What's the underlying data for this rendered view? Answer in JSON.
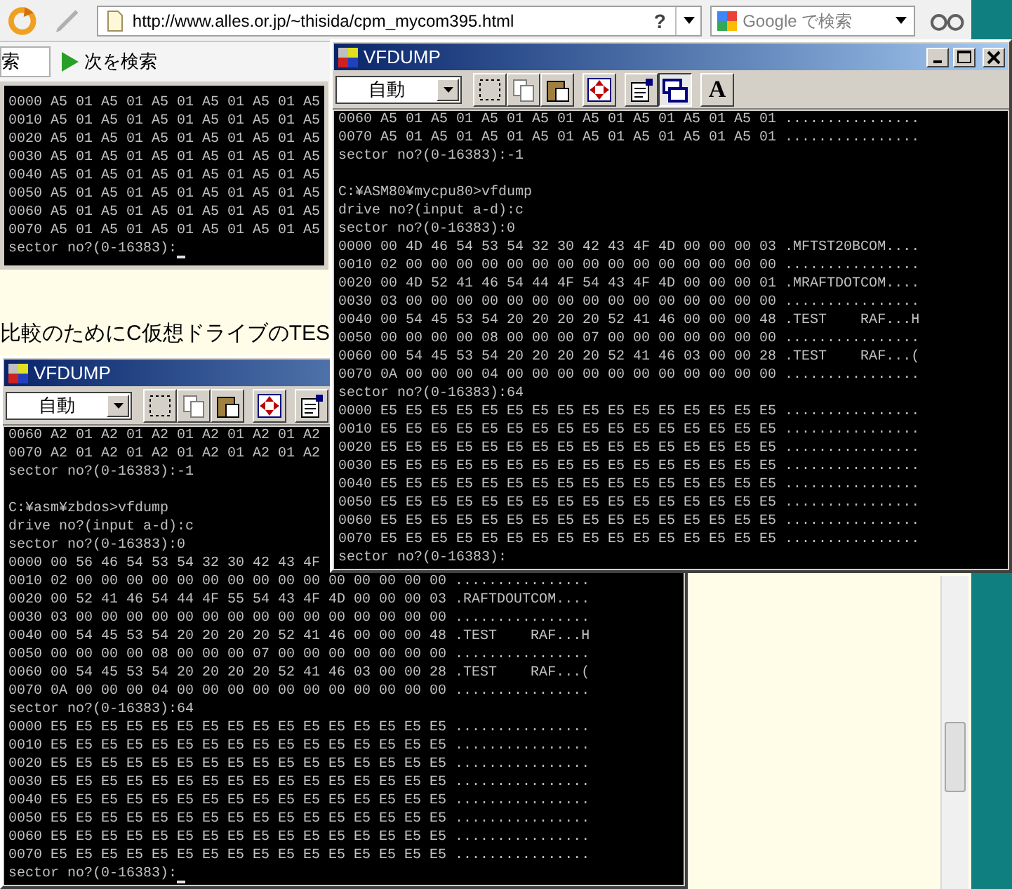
{
  "browser": {
    "url": "http://www.alles.or.jp/~thisida/cpm_mycom395.html",
    "help_button": "?",
    "search_placeholder": "Google で検索",
    "find_field_text": "索",
    "find_next": "次を検索"
  },
  "page": {
    "text": "比較のためにC仮想ドライブのTES"
  },
  "console_fragment": {
    "cursor": true,
    "lines": [
      "0000 A5 01 A5 01 A5 01 A5 01 A5 01 A5",
      "0010 A5 01 A5 01 A5 01 A5 01 A5 01 A5",
      "0020 A5 01 A5 01 A5 01 A5 01 A5 01 A5",
      "0030 A5 01 A5 01 A5 01 A5 01 A5 01 A5",
      "0040 A5 01 A5 01 A5 01 A5 01 A5 01 A5",
      "0050 A5 01 A5 01 A5 01 A5 01 A5 01 A5",
      "0060 A5 01 A5 01 A5 01 A5 01 A5 01 A5",
      "0070 A5 01 A5 01 A5 01 A5 01 A5 01 A5",
      "sector no?(0-16383):"
    ]
  },
  "windows": [
    {
      "title": "VFDUMP",
      "mode": "自動",
      "cursor": true,
      "blocks": [
        [
          "0060 A2 01 A2 01 A2 01 A2 01 A2 01 A2",
          "0070 A2 01 A2 01 A2 01 A2 01 A2 01 A2",
          "sector no?(0-16383):-1"
        ],
        [
          "C:¥asm¥zbdos>vfdump",
          "drive no?(input a-d):c",
          "sector no?(0-16383):0",
          "0000 00 56 46 54 53 54 32 30 42 43 4F",
          "0010 02 00 00 00 00 00 00 00 00 00 00 00 00 00 00 00 ................",
          "0020 00 52 41 46 54 44 4F 55 54 43 4F 4D 00 00 00 03 .RAFTDOUTCOM....",
          "0030 03 00 00 00 00 00 00 00 00 00 00 00 00 00 00 00 ................",
          "0040 00 54 45 53 54 20 20 20 20 52 41 46 00 00 00 48 .TEST    RAF...H",
          "0050 00 00 00 00 08 00 00 00 07 00 00 00 00 00 00 00 ................",
          "0060 00 54 45 53 54 20 20 20 20 52 41 46 03 00 00 28 .TEST    RAF...(",
          "0070 0A 00 00 00 04 00 00 00 00 00 00 00 00 00 00 00 ................",
          "sector no?(0-16383):64",
          "0000 E5 E5 E5 E5 E5 E5 E5 E5 E5 E5 E5 E5 E5 E5 E5 E5 ................",
          "0010 E5 E5 E5 E5 E5 E5 E5 E5 E5 E5 E5 E5 E5 E5 E5 E5 ................",
          "0020 E5 E5 E5 E5 E5 E5 E5 E5 E5 E5 E5 E5 E5 E5 E5 E5 ................",
          "0030 E5 E5 E5 E5 E5 E5 E5 E5 E5 E5 E5 E5 E5 E5 E5 E5 ................",
          "0040 E5 E5 E5 E5 E5 E5 E5 E5 E5 E5 E5 E5 E5 E5 E5 E5 ................",
          "0050 E5 E5 E5 E5 E5 E5 E5 E5 E5 E5 E5 E5 E5 E5 E5 E5 ................",
          "0060 E5 E5 E5 E5 E5 E5 E5 E5 E5 E5 E5 E5 E5 E5 E5 E5 ................",
          "0070 E5 E5 E5 E5 E5 E5 E5 E5 E5 E5 E5 E5 E5 E5 E5 E5 ................",
          "sector no?(0-16383):"
        ]
      ]
    },
    {
      "title": "VFDUMP",
      "mode": "自動",
      "font_button": "A",
      "background_button_pressed": true,
      "cursor": false,
      "blocks": [
        [
          "0060 A5 01 A5 01 A5 01 A5 01 A5 01 A5 01 A5 01 A5 01 ................",
          "0070 A5 01 A5 01 A5 01 A5 01 A5 01 A5 01 A5 01 A5 01 ................",
          "sector no?(0-16383):-1"
        ],
        [
          "C:¥ASM80¥mycpu80>vfdump",
          "drive no?(input a-d):c",
          "sector no?(0-16383):0",
          "0000 00 4D 46 54 53 54 32 30 42 43 4F 4D 00 00 00 03 .MFTST20BCOM....",
          "0010 02 00 00 00 00 00 00 00 00 00 00 00 00 00 00 00 ................",
          "0020 00 4D 52 41 46 54 44 4F 54 43 4F 4D 00 00 00 01 .MRAFTDOTCOM....",
          "0030 03 00 00 00 00 00 00 00 00 00 00 00 00 00 00 00 ................",
          "0040 00 54 45 53 54 20 20 20 20 52 41 46 00 00 00 48 .TEST    RAF...H",
          "0050 00 00 00 00 08 00 00 00 07 00 00 00 00 00 00 00 ................",
          "0060 00 54 45 53 54 20 20 20 20 52 41 46 03 00 00 28 .TEST    RAF...(",
          "0070 0A 00 00 00 04 00 00 00 00 00 00 00 00 00 00 00 ................",
          "sector no?(0-16383):64",
          "0000 E5 E5 E5 E5 E5 E5 E5 E5 E5 E5 E5 E5 E5 E5 E5 E5 ................",
          "0010 E5 E5 E5 E5 E5 E5 E5 E5 E5 E5 E5 E5 E5 E5 E5 E5 ................",
          "0020 E5 E5 E5 E5 E5 E5 E5 E5 E5 E5 E5 E5 E5 E5 E5 E5 ................",
          "0030 E5 E5 E5 E5 E5 E5 E5 E5 E5 E5 E5 E5 E5 E5 E5 E5 ................",
          "0040 E5 E5 E5 E5 E5 E5 E5 E5 E5 E5 E5 E5 E5 E5 E5 E5 ................",
          "0050 E5 E5 E5 E5 E5 E5 E5 E5 E5 E5 E5 E5 E5 E5 E5 E5 ................",
          "0060 E5 E5 E5 E5 E5 E5 E5 E5 E5 E5 E5 E5 E5 E5 E5 E5 ................",
          "0070 E5 E5 E5 E5 E5 E5 E5 E5 E5 E5 E5 E5 E5 E5 E5 E5 ................",
          "sector no?(0-16383):"
        ]
      ]
    }
  ]
}
